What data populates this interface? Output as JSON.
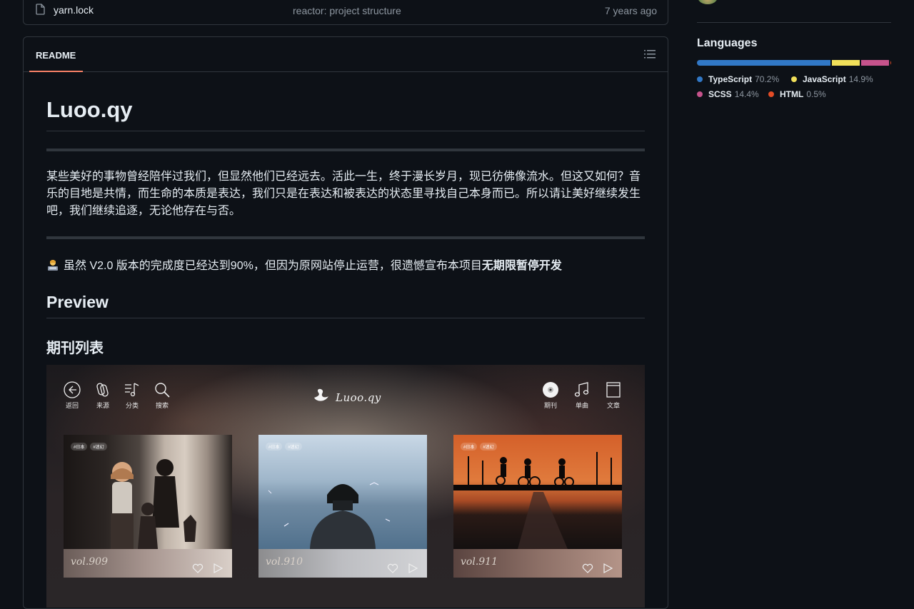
{
  "file_list": {
    "row": {
      "name": "yarn.lock",
      "message": "reactor: project structure",
      "time": "7 years ago"
    }
  },
  "readme": {
    "tab_label": "README",
    "title": "Luoo.qy",
    "intro": "某些美好的事物曾经陪伴过我们，但显然他们已经远去。活此一生，终于漫长岁月，现已彷佛像流水。但这又如何？音乐的目地是共情，而生命的本质是表达，我们只是在表达和被表达的状态里寻找自己本身而已。所以请让美好继续发生吧，我们继续追逐，无论他存在与否。",
    "note_text": "虽然 V2.0 版本的完成度已经达到90%，但因为原网站停止运营，很遗憾宣布本项目",
    "note_strong": "无期限暂停开发",
    "preview_heading": "Preview",
    "section_heading": "期刊列表"
  },
  "preview": {
    "logo_text": "Luoo.qy",
    "left_nav": [
      {
        "label": "返回",
        "icon": "back-icon"
      },
      {
        "label": "来源",
        "icon": "source-icon"
      },
      {
        "label": "分类",
        "icon": "category-icon"
      },
      {
        "label": "搜索",
        "icon": "search-icon"
      }
    ],
    "right_nav": [
      {
        "label": "期刊",
        "icon": "disc-icon"
      },
      {
        "label": "单曲",
        "icon": "music-note-icon"
      },
      {
        "label": "文章",
        "icon": "article-icon"
      }
    ],
    "cards": [
      {
        "vol": "vol.909",
        "tags": [
          "#日本",
          "#迷幻"
        ]
      },
      {
        "vol": "vol.910",
        "tags": [
          "#日本",
          "#迷幻"
        ]
      },
      {
        "vol": "vol.911",
        "tags": [
          "#日本",
          "#迷幻"
        ]
      }
    ]
  },
  "languages": {
    "title": "Languages",
    "items": [
      {
        "name": "TypeScript",
        "percent": "70.2%",
        "value": 70.2,
        "color": "#3178c6"
      },
      {
        "name": "JavaScript",
        "percent": "14.9%",
        "value": 14.9,
        "color": "#f1e05a"
      },
      {
        "name": "SCSS",
        "percent": "14.4%",
        "value": 14.4,
        "color": "#c6538c"
      },
      {
        "name": "HTML",
        "percent": "0.5%",
        "value": 0.5,
        "color": "#e34c26"
      }
    ]
  }
}
